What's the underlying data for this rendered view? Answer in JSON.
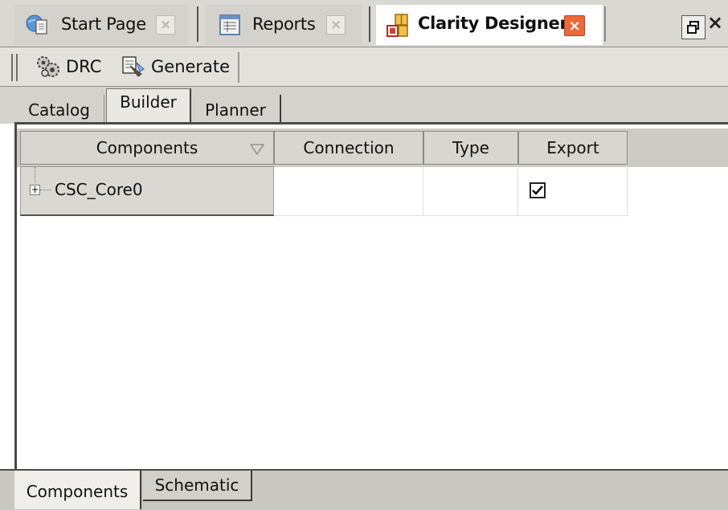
{
  "document_tabs": [
    {
      "label": "Start Page",
      "icon": "globe-page-icon",
      "active": false
    },
    {
      "label": "Reports",
      "icon": "report-table-icon",
      "active": false
    },
    {
      "label": "Clarity Designer",
      "icon": "clarity-designer-icon",
      "active": true
    }
  ],
  "window": {
    "close_glyph": "×"
  },
  "toolbar": {
    "drc_label": "DRC",
    "generate_label": "Generate"
  },
  "view_tabs": [
    {
      "label": "Catalog",
      "active": false
    },
    {
      "label": "Builder",
      "active": true
    },
    {
      "label": "Planner",
      "active": false
    }
  ],
  "grid": {
    "columns": [
      "Components",
      "Connection",
      "Type",
      "Export"
    ],
    "rows": [
      {
        "component": "CSC_Core0",
        "connection": "",
        "type": "",
        "export_checked": true
      }
    ]
  },
  "bottom_tabs": [
    {
      "label": "Components",
      "active": true
    },
    {
      "label": "Schematic",
      "active": false
    }
  ],
  "colors": {
    "active_close": "#ea6a3b",
    "frame": "#4b4a47",
    "chrome": "#d3d2cd"
  }
}
